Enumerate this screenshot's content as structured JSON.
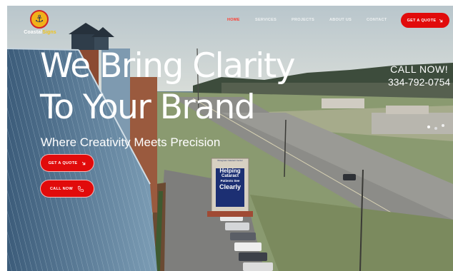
{
  "brand": {
    "name_part1": "Coastal",
    "name_part2": "Signs",
    "badge_glyph": "⚓"
  },
  "nav": {
    "items": [
      {
        "label": "HOME",
        "active": true
      },
      {
        "label": "SERVICES",
        "active": false
      },
      {
        "label": "PROJECTS",
        "active": false
      },
      {
        "label": "ABOUT US",
        "active": false
      },
      {
        "label": "CONTACT",
        "active": false
      }
    ],
    "cta_label": "GET A QUOTE"
  },
  "hero": {
    "headline_line1": "We Bring Clarity",
    "headline_line2": "To Your Brand",
    "subheadline": "Where Creativity Meets Precision",
    "quote_button": "GET A QUOTE",
    "call_button": "CALL NOW",
    "call_heading": "CALL NOW!",
    "phone": "334-792-0754"
  },
  "roadside_sign": {
    "top_text": "Wiregrass Cataract Center",
    "line1": "Helping",
    "line2": "Cataract",
    "line3": "Patients See",
    "line4": "Clearly"
  },
  "colors": {
    "accent": "#e10b0b",
    "nav_active": "#ff3b2f",
    "logo_gold": "#f3c418"
  }
}
